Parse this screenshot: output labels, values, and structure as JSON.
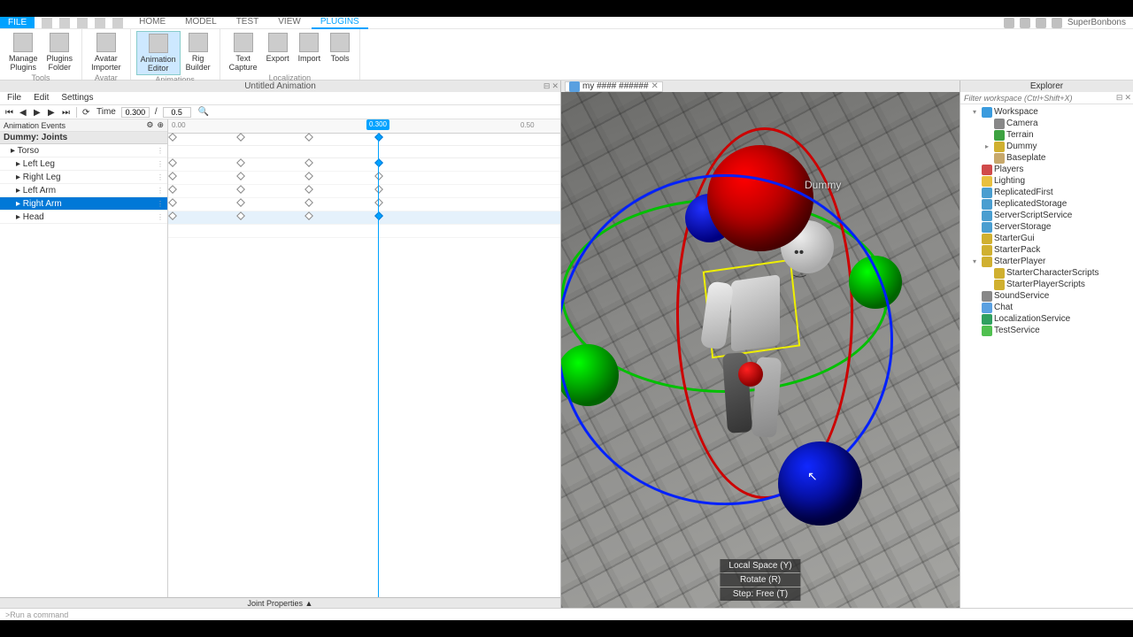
{
  "menubar": {
    "file": "FILE",
    "tabs": [
      "HOME",
      "MODEL",
      "TEST",
      "VIEW",
      "PLUGINS"
    ],
    "activeTab": "PLUGINS",
    "user": "SuperBonbons"
  },
  "ribbon": {
    "groups": [
      {
        "label": "Tools",
        "items": [
          {
            "label1": "Manage",
            "label2": "Plugins"
          },
          {
            "label1": "Plugins",
            "label2": "Folder"
          }
        ]
      },
      {
        "label": "Avatar",
        "items": [
          {
            "label1": "Avatar",
            "label2": "Importer"
          }
        ]
      },
      {
        "label": "Animations",
        "items": [
          {
            "label1": "Animation",
            "label2": "Editor",
            "active": true
          },
          {
            "label1": "Rig",
            "label2": "Builder"
          }
        ]
      },
      {
        "label": "Localization",
        "items": [
          {
            "label1": "Text",
            "label2": "Capture"
          },
          {
            "label1": "Export",
            "label2": ""
          },
          {
            "label1": "Import",
            "label2": ""
          },
          {
            "label1": "Tools",
            "label2": ""
          }
        ]
      }
    ]
  },
  "animPanel": {
    "title": "Untitled Animation",
    "menus": [
      "File",
      "Edit",
      "Settings"
    ],
    "timeLabel": "Time",
    "timeCurrent": "0.300",
    "timeEnd": "0.5",
    "eventsLabel": "Animation Events",
    "dummyHeader": "Dummy: Joints",
    "tracks": [
      {
        "name": "Torso",
        "child": false,
        "sel": false
      },
      {
        "name": "Left Leg",
        "child": true,
        "sel": false
      },
      {
        "name": "Right Leg",
        "child": true,
        "sel": false
      },
      {
        "name": "Left Arm",
        "child": true,
        "sel": false
      },
      {
        "name": "Right Arm",
        "child": true,
        "sel": true
      },
      {
        "name": "Head",
        "child": true,
        "sel": false
      }
    ],
    "rulerTicks": [
      {
        "pos": 4,
        "label": "0.00"
      },
      {
        "pos": 398,
        "label": "0.50"
      }
    ],
    "scrubPos": 237,
    "scrubLabel": "0.300",
    "kfCols": [
      4,
      81,
      158,
      237
    ],
    "jointPropsLabel": "Joint Properties ▲"
  },
  "viewport": {
    "tabLabel": "my #### ######",
    "dummyLabel": "Dummy",
    "overlay": [
      "Local Space (Y)",
      "Rotate (R)",
      "Step: Free (T)"
    ]
  },
  "explorer": {
    "title": "Explorer",
    "filterPlaceholder": "Filter workspace (Ctrl+Shift+X)",
    "tree": [
      {
        "name": "Workspace",
        "ind": 1,
        "exp": "▾",
        "color": "#3a9bde"
      },
      {
        "name": "Camera",
        "ind": 2,
        "exp": "",
        "color": "#888"
      },
      {
        "name": "Terrain",
        "ind": 2,
        "exp": "",
        "color": "#3da241"
      },
      {
        "name": "Dummy",
        "ind": 2,
        "exp": "▸",
        "color": "#d0b030"
      },
      {
        "name": "Baseplate",
        "ind": 2,
        "exp": "",
        "color": "#c7a86b"
      },
      {
        "name": "Players",
        "ind": 1,
        "exp": "",
        "color": "#d04a4a"
      },
      {
        "name": "Lighting",
        "ind": 1,
        "exp": "",
        "color": "#e8c040"
      },
      {
        "name": "ReplicatedFirst",
        "ind": 1,
        "exp": "",
        "color": "#4a9ed0"
      },
      {
        "name": "ReplicatedStorage",
        "ind": 1,
        "exp": "",
        "color": "#4a9ed0"
      },
      {
        "name": "ServerScriptService",
        "ind": 1,
        "exp": "",
        "color": "#4a9ed0"
      },
      {
        "name": "ServerStorage",
        "ind": 1,
        "exp": "",
        "color": "#4a9ed0"
      },
      {
        "name": "StarterGui",
        "ind": 1,
        "exp": "",
        "color": "#d0b030"
      },
      {
        "name": "StarterPack",
        "ind": 1,
        "exp": "",
        "color": "#d0b030"
      },
      {
        "name": "StarterPlayer",
        "ind": 1,
        "exp": "▾",
        "color": "#d0b030"
      },
      {
        "name": "StarterCharacterScripts",
        "ind": 2,
        "exp": "",
        "color": "#d0b030"
      },
      {
        "name": "StarterPlayerScripts",
        "ind": 2,
        "exp": "",
        "color": "#d0b030"
      },
      {
        "name": "SoundService",
        "ind": 1,
        "exp": "",
        "color": "#888"
      },
      {
        "name": "Chat",
        "ind": 1,
        "exp": "",
        "color": "#5aa0e0"
      },
      {
        "name": "LocalizationService",
        "ind": 1,
        "exp": "",
        "color": "#30a060"
      },
      {
        "name": "TestService",
        "ind": 1,
        "exp": "",
        "color": "#50c050"
      }
    ]
  },
  "cmd": {
    "placeholder": "Run a command"
  }
}
